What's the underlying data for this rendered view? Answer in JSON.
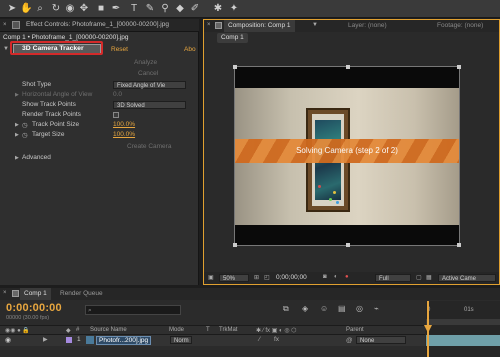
{
  "effect_controls": {
    "tab_title": "Effect Controls: Photoframe_1_[00000-00200].jpg",
    "breadcrumb": "Comp 1 • Photoframe_1_[00000-00200].jpg",
    "effect_name": "3D Camera Tracker",
    "reset_label": "Reset",
    "about_label": "Abo",
    "analyze_label": "Analyze",
    "cancel_label": "Cancel",
    "shot_type_label": "Shot Type",
    "shot_type_value": "Fixed Angle of Vie",
    "hangle_label": "Horizontal Angle of View",
    "hangle_value": "0.0",
    "show_track_label": "Show Track Points",
    "show_track_value": "3D Solved",
    "render_track_label": "Render Track Points",
    "track_size_label": "Track Point Size",
    "track_size_value": "100.0%",
    "target_size_label": "Target Size",
    "target_size_value": "100.0%",
    "create_camera_label": "Create Camera",
    "advanced_label": "Advanced"
  },
  "composition": {
    "tab_title": "Composition: Comp 1",
    "layer_tab": "Layer: (none)",
    "footage_tab": "Footage: (none)",
    "sub_tab": "Comp 1",
    "banner_text": "Solving Camera (step 2 of 2)",
    "zoom": "50%",
    "timecode": "0;00;00;00",
    "resolution": "Full",
    "active_camera": "Active Came"
  },
  "timeline": {
    "comp_tab": "Comp 1",
    "render_tab": "Render Queue",
    "timecode": "0:00:00:00",
    "frame_info": "00000 (30.00 fps)",
    "col_num": "#",
    "col_source": "Source Name",
    "col_mode": "Mode",
    "col_t": "T",
    "col_trkmat": "TrkMat",
    "col_parent": "Parent",
    "layer_num": "1",
    "layer_name": "Photofr...200].jpg",
    "layer_mode": "Norm",
    "layer_parent": "None",
    "ruler_0": "0",
    "ruler_1": "01s"
  },
  "colors": {
    "accent": "#e7a63f",
    "banner": "#e07a2a",
    "highlight": "#d42a2a"
  }
}
